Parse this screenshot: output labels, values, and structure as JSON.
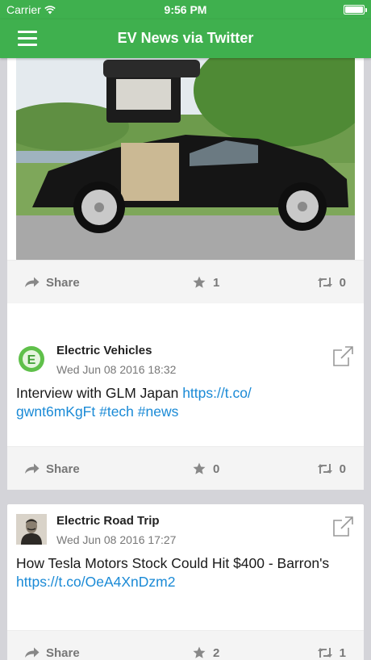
{
  "status": {
    "carrier": "Carrier",
    "time": "9:56 PM"
  },
  "nav": {
    "title": "EV News via Twitter"
  },
  "colors": {
    "brand": "#3fb04e",
    "link": "#1a8ad6"
  },
  "tweets": [
    {
      "image": "photo of black Tesla Model X with falcon-wing door open",
      "actions": {
        "share": "Share",
        "likes": "1",
        "retweets": "0"
      }
    },
    {
      "author": "Electric Vehicles",
      "date": "Wed Jun 08 2016 18:32",
      "text": "Interview with GLM Japan ",
      "links": [
        "https://t.co/",
        "gwnt6mKgFt",
        "#tech",
        "#news"
      ],
      "actions": {
        "share": "Share",
        "likes": "0",
        "retweets": "0"
      }
    },
    {
      "author": "Electric Road Trip",
      "date": "Wed Jun 08 2016 17:27",
      "text": "How Tesla Motors Stock Could Hit $400 - Barron's ",
      "links": [
        "https://t.co/OeA4XnDzm2"
      ],
      "actions": {
        "share": "Share",
        "likes": "2",
        "retweets": "1"
      }
    }
  ]
}
